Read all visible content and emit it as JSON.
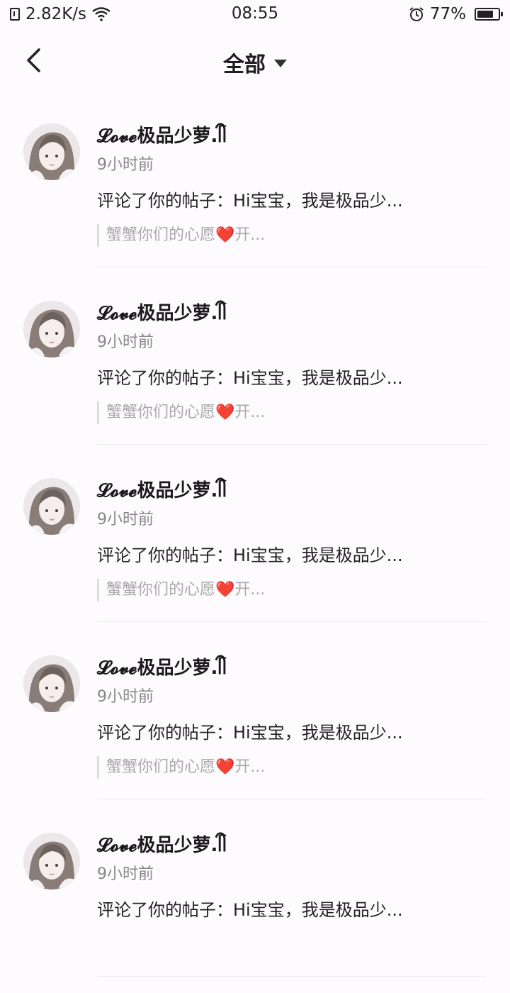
{
  "status_bar": {
    "network_speed": "2.82K/s",
    "time": "08:55",
    "battery_percent": "77%",
    "battery_level": 0.77,
    "icons": [
      "sim-icon",
      "wifi-icon",
      "alarm-icon",
      "battery-icon"
    ]
  },
  "nav": {
    "back_icon": "back-arrow-icon",
    "title": "全部",
    "dropdown_icon": "caret-down-icon"
  },
  "notifications": [
    {
      "user_name": "𝓛𝓸𝓿𝓮极品少萝.ᥬᩤ",
      "time": "9小时前",
      "comment": "评论了你的帖子：Hi宝宝，我是极品少...",
      "quote": "蟹蟹你们的心愿❤️开..."
    },
    {
      "user_name": "𝓛𝓸𝓿𝓮极品少萝.ᥬᩤ",
      "time": "9小时前",
      "comment": "评论了你的帖子：Hi宝宝，我是极品少...",
      "quote": "蟹蟹你们的心愿❤️开..."
    },
    {
      "user_name": "𝓛𝓸𝓿𝓮极品少萝.ᥬᩤ",
      "time": "9小时前",
      "comment": "评论了你的帖子：Hi宝宝，我是极品少...",
      "quote": "蟹蟹你们的心愿❤️开..."
    },
    {
      "user_name": "𝓛𝓸𝓿𝓮极品少萝.ᥬᩤ",
      "time": "9小时前",
      "comment": "评论了你的帖子：Hi宝宝，我是极品少...",
      "quote": "蟹蟹你们的心愿❤️开..."
    },
    {
      "user_name": "𝓛𝓸𝓿𝓮极品少萝.ᥬᩤ",
      "time": "9小时前",
      "comment": "评论了你的帖子：Hi宝宝，我是极品少...",
      "quote": ""
    }
  ]
}
